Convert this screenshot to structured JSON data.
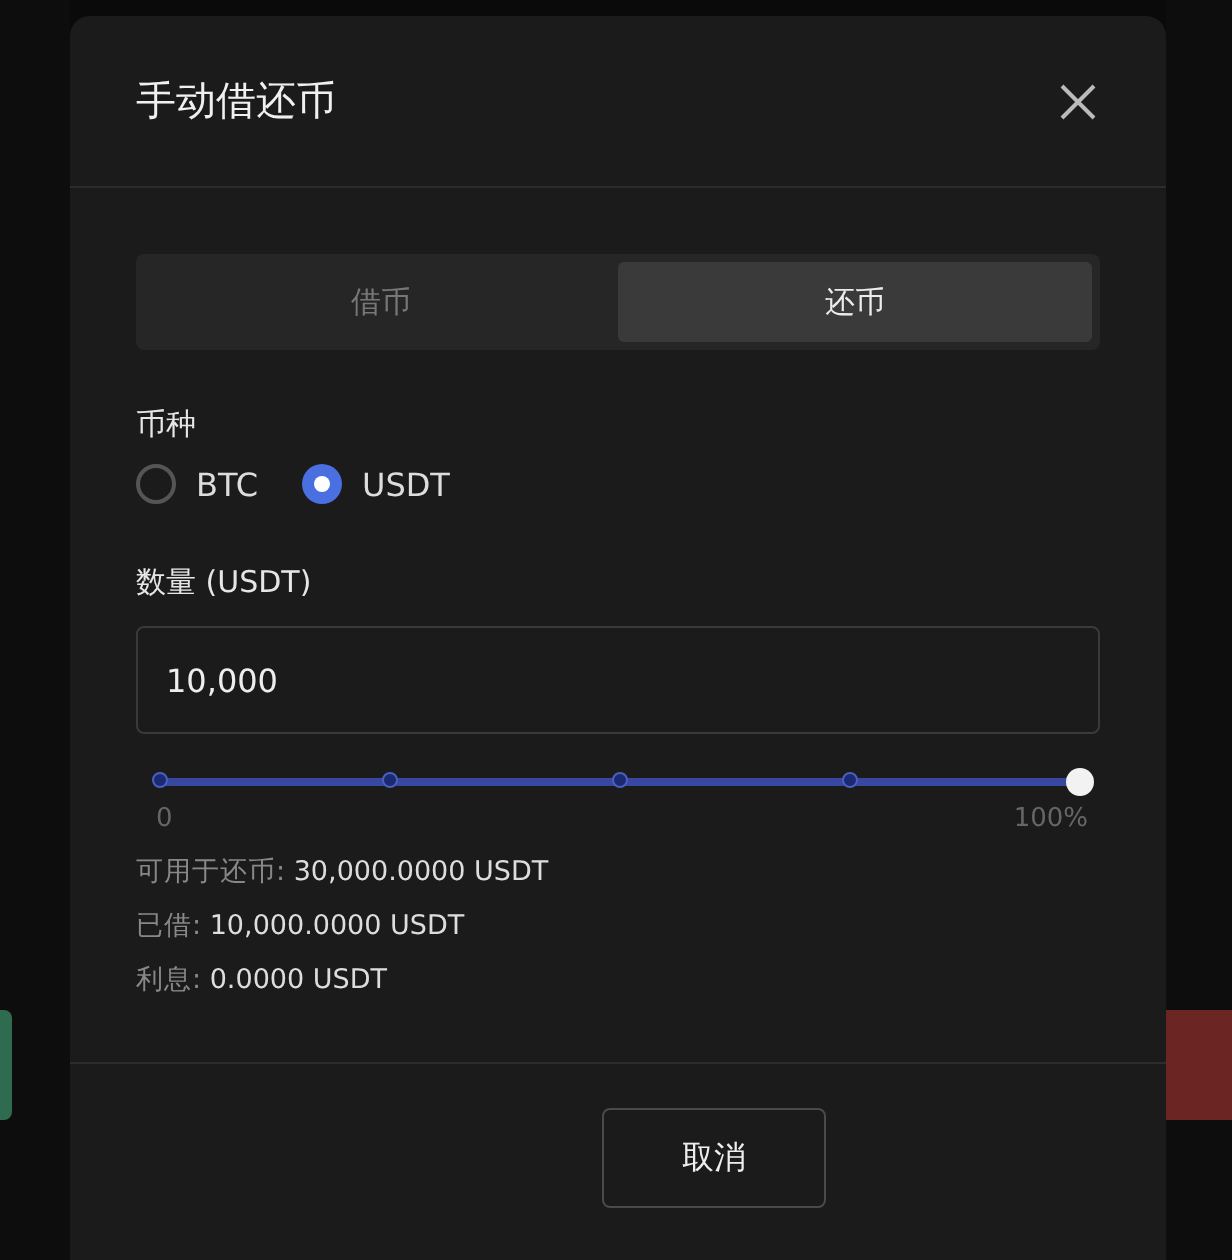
{
  "dialog": {
    "title": "手动借还币"
  },
  "tabs": [
    {
      "label": "借币",
      "selected": false
    },
    {
      "label": "还币",
      "selected": true
    }
  ],
  "currency": {
    "label": "币种",
    "options": [
      {
        "label": "BTC",
        "selected": false
      },
      {
        "label": "USDT",
        "selected": true
      }
    ]
  },
  "amount": {
    "label": "数量 (USDT)",
    "value": "10,000"
  },
  "slider": {
    "level": 1,
    "min_label": "0",
    "max_label": "100%"
  },
  "info": [
    {
      "label": "可用于还币:",
      "value": "30,000.0000 USDT"
    },
    {
      "label": "已借:",
      "value": "10,000.0000 USDT"
    },
    {
      "label": "利息:",
      "value": "0.0000 USDT"
    }
  ],
  "buttons": [
    {
      "label": "取消"
    }
  ]
}
